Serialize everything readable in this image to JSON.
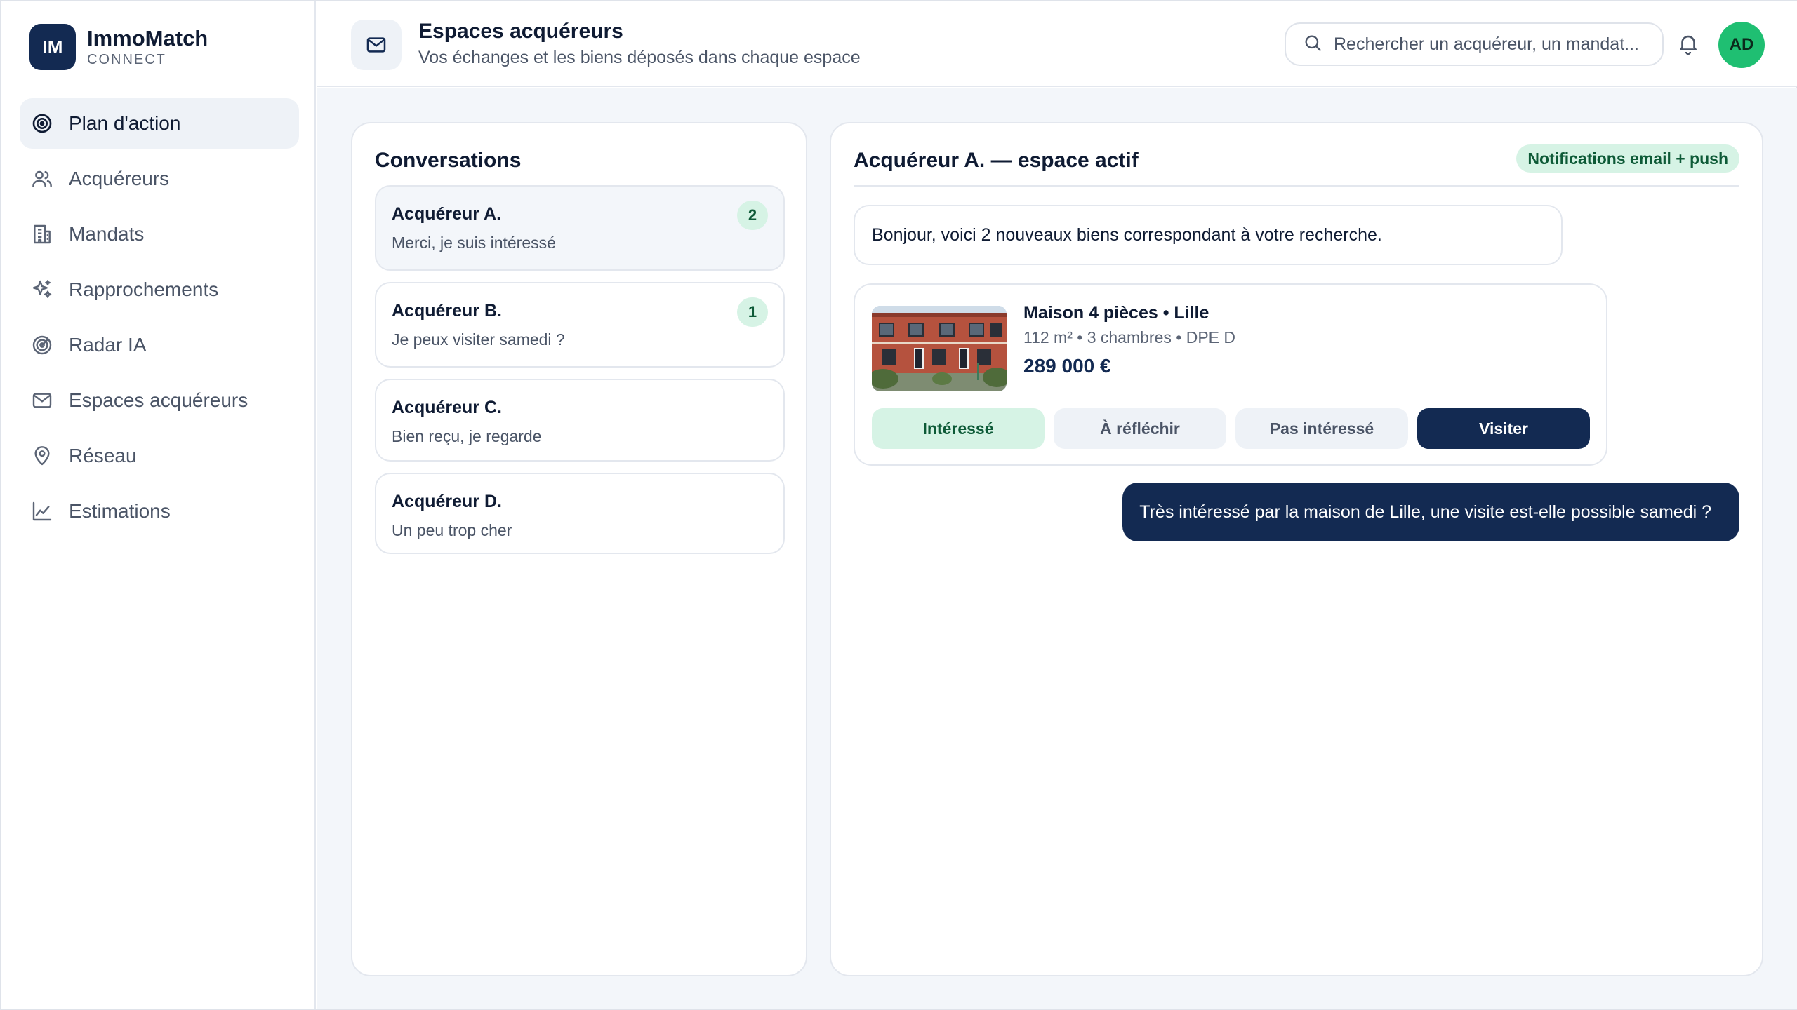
{
  "brand": {
    "initials": "IM",
    "name": "ImmoMatch",
    "sub": "CONNECT"
  },
  "nav": [
    {
      "label": "Plan d'action",
      "icon": "target-icon",
      "active": true
    },
    {
      "label": "Acquéreurs",
      "icon": "users-icon"
    },
    {
      "label": "Mandats",
      "icon": "building-icon"
    },
    {
      "label": "Rapprochements",
      "icon": "sparkles-icon"
    },
    {
      "label": "Radar IA",
      "icon": "radar-icon"
    },
    {
      "label": "Espaces acquéreurs",
      "icon": "mail-icon"
    },
    {
      "label": "Réseau",
      "icon": "map-pin-icon"
    },
    {
      "label": "Estimations",
      "icon": "chart-line-icon"
    }
  ],
  "header": {
    "title": "Espaces acquéreurs",
    "subtitle": "Vos échanges et les biens déposés dans chaque espace",
    "search_placeholder": "Rechercher un acquéreur, un mandat...",
    "avatar": "AD"
  },
  "conversations": {
    "title": "Conversations",
    "items": [
      {
        "name": "Acquéreur A.",
        "preview": "Merci, je suis intéressé",
        "badge": "2",
        "active": true
      },
      {
        "name": "Acquéreur B.",
        "preview": "Je peux visiter samedi ?",
        "badge": "1"
      },
      {
        "name": "Acquéreur C.",
        "preview": "Bien reçu, je regarde",
        "badge": null
      },
      {
        "name": "Acquéreur D.",
        "preview": "Un peu trop cher",
        "badge": null
      }
    ]
  },
  "chat": {
    "title": "Acquéreur A. — espace actif",
    "notifications": "Notifications email + push",
    "incoming_message": "Bonjour, voici 2 nouveaux biens correspondant à votre recherche.",
    "property": {
      "title": "Maison 4 pièces • Lille",
      "details": "112 m² • 3 chambres • DPE D",
      "price": "289 000 €",
      "actions": {
        "interested": "Intéressé",
        "think": "À réfléchir",
        "not_interested": "Pas intéressé",
        "visit": "Visiter"
      }
    },
    "outgoing_message": "Très intéressé par la maison de Lille, une visite est-elle possible samedi ?"
  },
  "colors": {
    "navy": "#132a52",
    "green_bg": "#d6f3e5",
    "green_text": "#0d5a37",
    "avatar_green": "#1fbf72"
  }
}
